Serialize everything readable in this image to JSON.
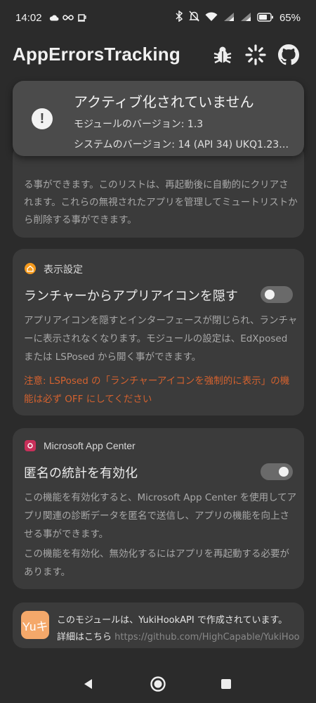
{
  "status_bar": {
    "time": "14:02",
    "left_icons": [
      "cloud-icon",
      "infinity-icon",
      "cup-icon"
    ],
    "right_icons": [
      "bluetooth-icon",
      "bell-off-icon",
      "wifi-icon",
      "signal-icon",
      "signal-icon",
      "battery-icon"
    ],
    "battery": "65%"
  },
  "app_bar": {
    "title": "AppErrorsTracking",
    "actions": [
      "bug-icon",
      "loading-icon",
      "github-icon"
    ]
  },
  "status_card": {
    "title": "アクティブ化されていません",
    "module_version": "モジュールのバージョン: 1.3",
    "system_version": "システムのバージョン: 14 (API 34) UKQ1.23…",
    "icon": "alert-icon"
  },
  "partial_card": {
    "text": "る事ができます。このリストは、再起動後に自動的にクリアされます。これらの無視されたアプリを管理してミュートリストから削除する事ができます。"
  },
  "display_settings": {
    "section_title": "表示設定",
    "icon": "home-icon",
    "icon_color": "#f59a1d",
    "hide_icon_label": "ランチャーからアプリアイコンを隠す",
    "hide_icon_enabled": false,
    "description": "アプリアイコンを隠すとインターフェースが閉じられ、ランチャーに表示されなくなります。モジュールの設定は、EdXposed または LSPosed から開く事ができます。",
    "warning": "注意: LSPosed の「ランチャーアイコンを強制的に表示」の機能は必ず OFF にしてください",
    "warning_color": "#d4622f"
  },
  "app_center": {
    "section_title": "Microsoft App Center",
    "icon": "app-center-icon",
    "icon_color": "#c8305a",
    "anon_stats_label": "匿名の統計を有効化",
    "anon_stats_enabled": true,
    "description1": "この機能を有効化すると、Microsoft App Center を使用してアプリ関連の診断データを匿名で送信し、アプリの機能を向上させる事ができます。",
    "description2": "この機能を有効化、無効化するにはアプリを再起動する必要があります。"
  },
  "footer": {
    "logo_text": "Yuキ",
    "line1": "このモジュールは、YukiHookAPI で作成されています。",
    "details_label": "詳細はこちら",
    "link": "https://github.com/HighCapable/YukiHookAPI"
  },
  "nav_bar": {
    "buttons": [
      "back-icon",
      "home-button-icon",
      "recents-icon"
    ]
  }
}
